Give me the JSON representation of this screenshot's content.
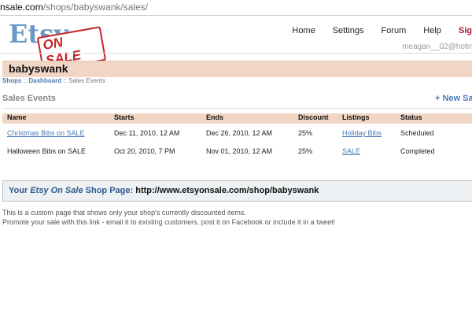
{
  "browser": {
    "url_host": "nsale.com",
    "url_path": "/shops/babyswank/sales/"
  },
  "logo": {
    "word1": "Etsy",
    "word2": "ON SALE"
  },
  "nav": {
    "items": [
      "Home",
      "Settings",
      "Forum",
      "Help"
    ],
    "signout": "Sig"
  },
  "user": {
    "email": "meagan__02@hotm"
  },
  "shop": {
    "name": "babyswank"
  },
  "breadcrumb": {
    "shops": "Shops",
    "dashboard": "Dashboard",
    "sep": "::",
    "current": "Sales Events"
  },
  "section": {
    "title": "Sales Events",
    "new_label": "+ New Sale"
  },
  "table": {
    "headers": [
      "Name",
      "Starts",
      "Ends",
      "Discount",
      "Listings",
      "Status"
    ],
    "rows": [
      {
        "name": "Christmas Bibs on SALE",
        "starts": "Dec 11, 2010, 12 AM",
        "ends": "Dec 26, 2010, 12 AM",
        "discount": "25%",
        "listings": "Holiday Bibs",
        "status": "Scheduled"
      },
      {
        "name": "Halloween Bibs on SALE",
        "starts": "Oct 20, 2010, 7 PM",
        "ends": "Nov 01, 2010, 12 AM",
        "discount": "25%",
        "listings": "SALE",
        "status": "Completed"
      }
    ]
  },
  "shop_page": {
    "your": "Your",
    "brand": "Etsy On Sale",
    "label": "Shop Page:",
    "url": "http://www.etsyonsale.com/shop/babyswank"
  },
  "notes": {
    "line1": "This is a custom page that shows only your shop's currently discounted items.",
    "line2": "Promote your sale with this link - email it to existing customers, post it on Facebook or include it in a tweet!"
  }
}
